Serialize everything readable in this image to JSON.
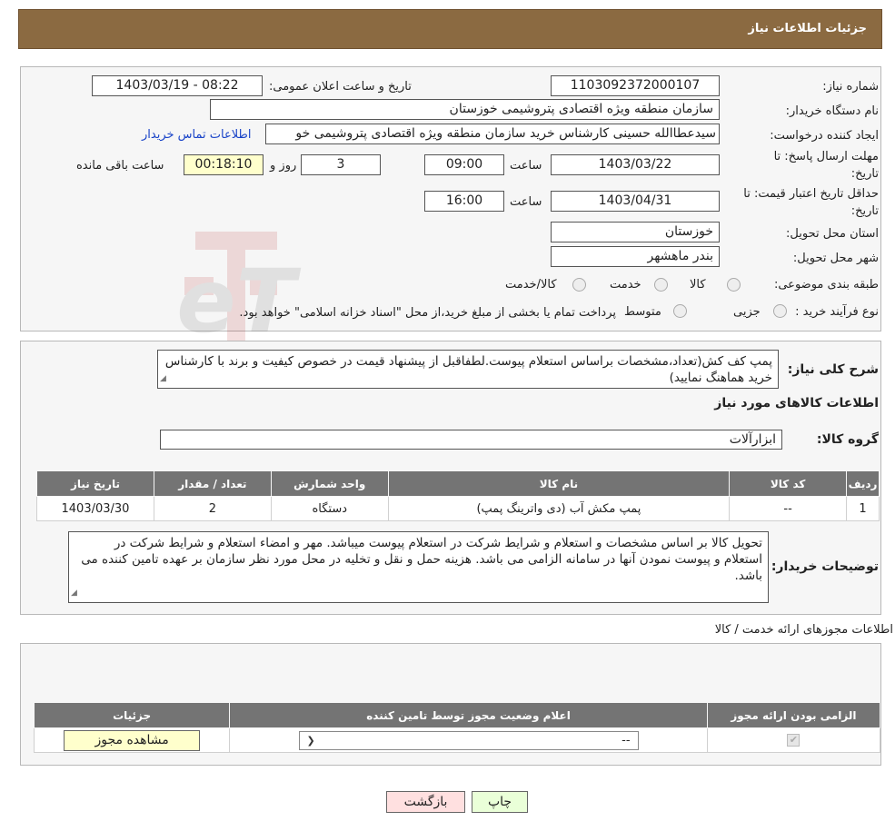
{
  "header": {
    "title": "جزئیات اطلاعات نیاز"
  },
  "info": {
    "need_number_label": "شماره نیاز:",
    "need_number": "1103092372000107",
    "announce_label": "تاریخ و ساعت اعلان عمومی:",
    "announce_value": "1403/03/19 - 08:22",
    "buyer_label": "نام دستگاه خریدار:",
    "buyer_value": "سازمان منطقه ویژه اقتصادی پتروشیمی خوزستان",
    "creator_label": "ایجاد کننده درخواست:",
    "creator_value": "سیدعطاالله حسینی کارشناس خرید سازمان منطقه ویژه اقتصادی پتروشیمی خو",
    "contact_link": "اطلاعات تماس خریدار",
    "deadline_label_1": "مهلت ارسال پاسخ: تا",
    "deadline_label_2": "تاریخ:",
    "deadline_date": "1403/03/22",
    "time_label": "ساعت",
    "deadline_time": "09:00",
    "days_value": "3",
    "days_label": "روز و",
    "remaining_value": "00:18:10",
    "remaining_label": "ساعت باقی مانده",
    "validity_label_1": "حداقل تاریخ اعتبار قیمت: تا",
    "validity_label_2": "تاریخ:",
    "validity_date": "1403/04/31",
    "validity_time_label": "ساعت",
    "validity_time": "16:00",
    "province_label": "استان محل تحویل:",
    "province_value": "خوزستان",
    "city_label": "شهر محل تحویل:",
    "city_value": "بندر ماهشهر",
    "category_label": "طبقه بندی موضوعی:",
    "category_options": [
      "کالا",
      "خدمت",
      "کالا/خدمت"
    ],
    "process_label": "نوع فرآیند خرید :",
    "process_options": [
      "جزیی",
      "متوسط"
    ],
    "process_note": "پرداخت تمام یا بخشی از مبلغ خرید،از محل \"اسناد خزانه اسلامی\" خواهد بود."
  },
  "description": {
    "label": "شرح کلی نیاز:",
    "text": "پمپ کف کش(تعداد،مشخصات براساس استعلام پیوست.لطفاقبل از پیشنهاد قیمت در خصوص کیفیت و برند با کارشناس خرید هماهنگ نمایید)"
  },
  "goods": {
    "section_title": "اطلاعات کالاهای مورد نیاز",
    "group_label": "گروه کالا:",
    "group_value": "ابزارآلات",
    "columns": [
      "ردیف",
      "کد کالا",
      "نام کالا",
      "واحد شمارش",
      "تعداد / مقدار",
      "تاریخ نیاز"
    ],
    "rows": [
      {
        "index": "1",
        "code": "--",
        "name": "پمپ مکش آب (دی واترینگ پمپ)",
        "unit": "دستگاه",
        "qty": "2",
        "date": "1403/03/30"
      }
    ]
  },
  "buyer_notes": {
    "label": "توضیحات خریدار:",
    "text": "تحویل کالا بر اساس  مشخصات و استعلام و شرایط شرکت در استعلام پیوست میباشد. مهر و امضاء استعلام و شرایط شرکت در استعلام و پیوست نمودن آنها در سامانه الزامی می باشد. هزینه حمل و نقل و تخلیه در محل مورد نظر سازمان بر عهده تامین کننده می باشد."
  },
  "permits": {
    "section_title": "اطلاعات مجوزهای ارائه خدمت / کالا",
    "columns": [
      "الزامی بودن ارائه مجوز",
      "اعلام وضعیت مجوز توسط تامین کننده",
      "جزئیات"
    ],
    "select_value": "--",
    "view_button": "مشاهده مجوز"
  },
  "footer": {
    "print_button": "چاپ",
    "back_button": "بازگشت"
  },
  "watermark_text": "AriaTender.neT"
}
